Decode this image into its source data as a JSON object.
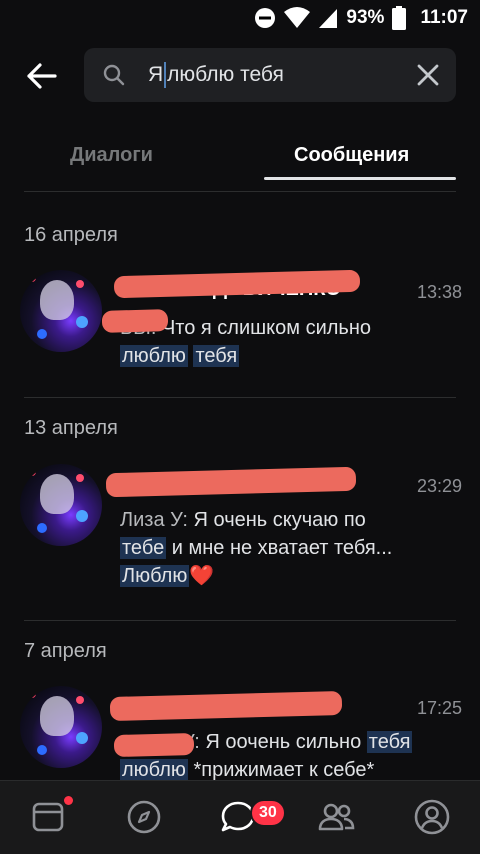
{
  "status_bar": {
    "battery": "93%",
    "time": "11:07"
  },
  "search": {
    "query_before_caret": "Я",
    "query_after_caret": "люблю тебя"
  },
  "tabs": {
    "dialogs": "Диалоги",
    "messages": "Сообщения",
    "active": "messages"
  },
  "groups": [
    {
      "date": "16 апреля",
      "message": {
        "time": "13:38",
        "sender_visible_fragment": "ГДОВИЧЕНКО",
        "prefix_fragment": "ЬЫ:",
        "text_plain": "Что я слишком сильно",
        "hl1": "люблю",
        "hl2": "тебя"
      }
    },
    {
      "date": "13 апреля",
      "message": {
        "time": "23:29",
        "prefix_fragment": "Лиза У:",
        "t1": "Я очень скучаю по",
        "hl1": "тебе",
        "t2": "и мне не хватает тебя...",
        "hl2": "Люблю",
        "emoji": "❤️"
      }
    },
    {
      "date": "7 апреля",
      "message": {
        "time": "17:25",
        "prefix_fragment": "У:",
        "t1": "Я оочень сильно",
        "hl1": "тебя",
        "hl2": "люблю",
        "t2": "*прижимает к себе*"
      }
    }
  ],
  "bottom_nav": {
    "messages_badge": "30"
  },
  "colors": {
    "background": "#0d0d0f",
    "accent": "#5181b8",
    "badge": "#ff3347",
    "highlight": "#1e3352",
    "redaction": "#ec6a5e"
  }
}
